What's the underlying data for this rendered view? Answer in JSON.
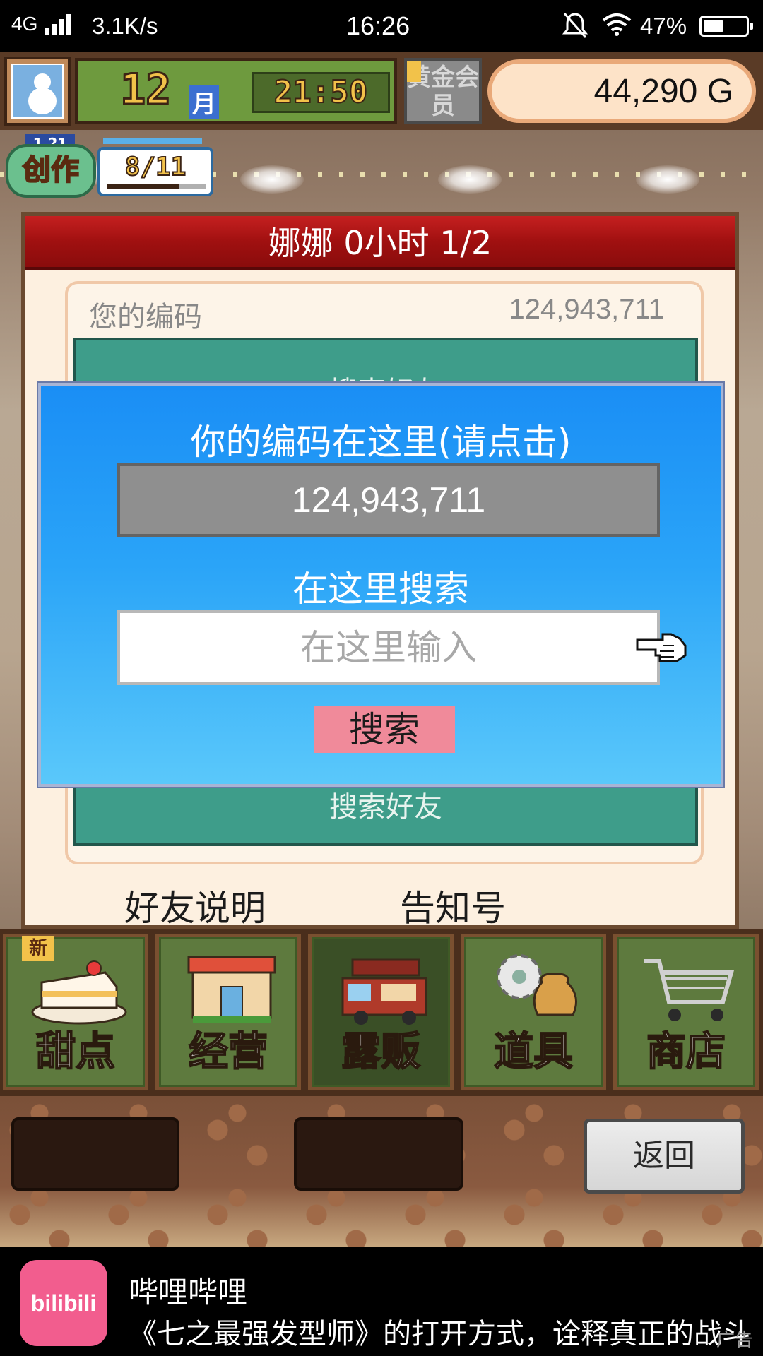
{
  "status_bar": {
    "network": "4G",
    "speed": "3.1K/s",
    "time": "16:26",
    "battery": "47%",
    "battery_level": 0.47
  },
  "hud": {
    "month_number": "12",
    "month_unit": "月",
    "clock": "21:50",
    "gold_member": "黄金会员",
    "money": "44,290 G"
  },
  "creation": {
    "label": "创作",
    "level": "1 21",
    "progress": "8/11",
    "progress_value": 0.727
  },
  "panel": {
    "title": "娜娜  0小时 1/2",
    "code_label": "您的编码",
    "code_value": "124,943,711",
    "peek_text": "搜索好友",
    "search_friend": "搜索好友",
    "friend_info": "好友说明",
    "notice": "告知号"
  },
  "dialog": {
    "title": "你的编码在这里(请点击)",
    "code": "124,943,711",
    "search_label": "在这里搜索",
    "input_placeholder": "在这里输入",
    "search_button": "搜索"
  },
  "nav": {
    "new_tag": "新",
    "items": [
      {
        "label": "甜点"
      },
      {
        "label": "经营"
      },
      {
        "label": "露贩"
      },
      {
        "label": "道具"
      },
      {
        "label": "商店"
      }
    ]
  },
  "toolbar": {
    "back_label": "返回"
  },
  "ad": {
    "icon_text": "bilibili",
    "app_name": "哔哩哔哩",
    "description": "《七之最强发型师》的打开方式，诠释真正的战斗",
    "ad_label": "广告"
  },
  "colors": {
    "dialog_blue": "#1a8ef5",
    "title_red": "#c52020",
    "search_pink": "#f08a9a",
    "teal": "#3e9d8a",
    "bilibili_pink": "#f25d8e"
  }
}
